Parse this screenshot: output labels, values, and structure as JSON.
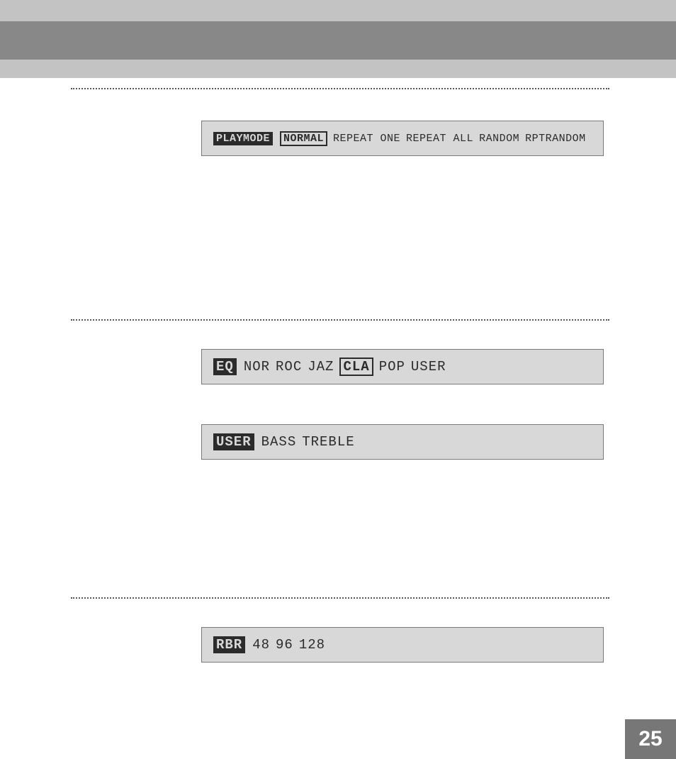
{
  "page_number": "25",
  "sections": {
    "playmode": {
      "label": "PLAYMODE",
      "selected": "NORMAL",
      "options_rest": [
        "REPEAT ONE",
        "REPEAT ALL",
        "RANDOM",
        "RPTRANDOM"
      ]
    },
    "eq": {
      "label": "EQ",
      "pre": [
        "NOR",
        "ROC",
        "JAZ"
      ],
      "selected": "CLA",
      "post": [
        "POP",
        "USER"
      ]
    },
    "user": {
      "label": "USER",
      "options": [
        "BASS",
        "TREBLE"
      ]
    },
    "rbr": {
      "label": "RBR",
      "options": [
        "48",
        "96",
        "128"
      ]
    }
  }
}
